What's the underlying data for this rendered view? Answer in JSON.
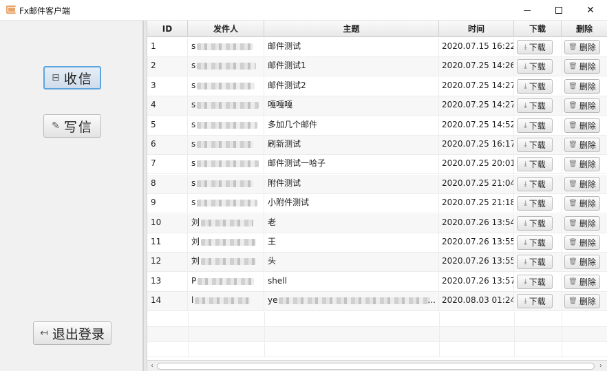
{
  "window": {
    "title": "Fx邮件客户端",
    "controls": {
      "minimize": "minimize-icon",
      "maximize": "maximize-icon",
      "close": "close-icon"
    }
  },
  "sidebar": {
    "receive": {
      "label": "收信",
      "icon": "inbox-icon"
    },
    "write": {
      "label": "写信",
      "icon": "compose-icon"
    },
    "logout": {
      "label": "退出登录",
      "icon": "logout-icon"
    }
  },
  "table": {
    "headers": {
      "id": "ID",
      "sender": "发件人",
      "subject": "主题",
      "time": "时间",
      "download": "下载",
      "delete": "删除"
    },
    "download_label": "下载",
    "delete_label": "删除",
    "rows": [
      {
        "id": "1",
        "sender": "s",
        "subject": "邮件测试",
        "time": "2020.07.15 16:22"
      },
      {
        "id": "2",
        "sender": "s",
        "subject": "邮件测试1",
        "time": "2020.07.25 14:26"
      },
      {
        "id": "3",
        "sender": "s",
        "subject": "邮件测试2",
        "time": "2020.07.25 14:27"
      },
      {
        "id": "4",
        "sender": "s",
        "subject": "嘎嘎嘎",
        "time": "2020.07.25 14:27"
      },
      {
        "id": "5",
        "sender": "s",
        "subject": "多加几个邮件",
        "time": "2020.07.25 14:52"
      },
      {
        "id": "6",
        "sender": "s",
        "subject": "刷新测试",
        "time": "2020.07.25 16:17"
      },
      {
        "id": "7",
        "sender": "s",
        "subject": "邮件测试一哈子",
        "time": "2020.07.25 20:01"
      },
      {
        "id": "8",
        "sender": "s",
        "subject": "附件测试",
        "time": "2020.07.25 21:04"
      },
      {
        "id": "9",
        "sender": "s",
        "subject": "小附件测试",
        "time": "2020.07.25 21:18"
      },
      {
        "id": "10",
        "sender": "刘",
        "subject": "老",
        "time": "2020.07.26 13:54"
      },
      {
        "id": "11",
        "sender": "刘",
        "subject": "王",
        "time": "2020.07.26 13:55"
      },
      {
        "id": "12",
        "sender": "刘",
        "subject": "头",
        "time": "2020.07.26 13:55"
      },
      {
        "id": "13",
        "sender": "P",
        "subject": "shell",
        "time": "2020.07.26 13:57"
      },
      {
        "id": "14",
        "sender": "l",
        "subject": "ye",
        "time": "2020.08.03 01:24"
      }
    ],
    "row14_subject_ellipsis": "..."
  },
  "scrollbar": {
    "left_arrow": "‹",
    "right_arrow": "›"
  }
}
